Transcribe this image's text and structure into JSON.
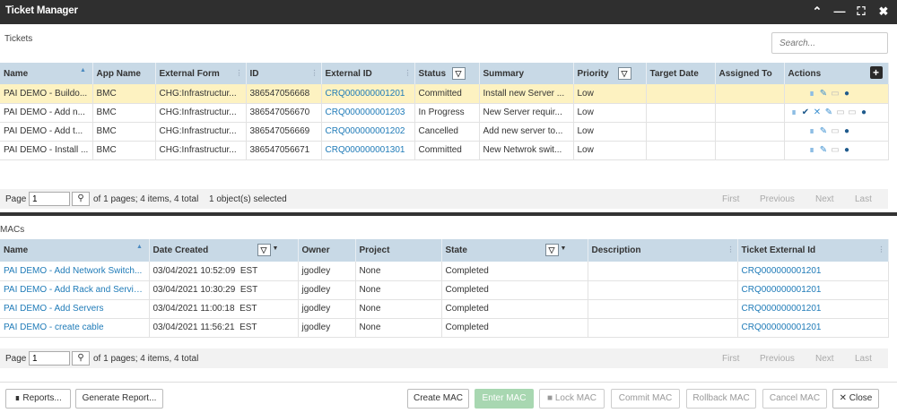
{
  "window": {
    "title": "Ticket Manager"
  },
  "tickets": {
    "section_label": "Tickets",
    "search_placeholder": "Search...",
    "columns": [
      "Name",
      "App Name",
      "External Form",
      "ID",
      "External ID",
      "Status",
      "Summary",
      "Priority",
      "Target Date",
      "Assigned To",
      "Actions"
    ],
    "rows": [
      {
        "name": "PAI DEMO - Buildo...",
        "app": "BMC",
        "form": "CHG:Infrastructur...",
        "id": "386547056668",
        "ext_id": "CRQ000000001201",
        "status": "Committed",
        "summary": "Install new Server ...",
        "priority": "Low",
        "target": "",
        "assigned": ""
      },
      {
        "name": "PAI DEMO - Add n...",
        "app": "BMC",
        "form": "CHG:Infrastructur...",
        "id": "386547056670",
        "ext_id": "CRQ000000001203",
        "status": "In Progress",
        "summary": "New Server requir...",
        "priority": "Low",
        "target": "",
        "assigned": ""
      },
      {
        "name": "PAI DEMO - Add t...",
        "app": "BMC",
        "form": "CHG:Infrastructur...",
        "id": "386547056669",
        "ext_id": "CRQ000000001202",
        "status": "Cancelled",
        "summary": "Add new server to...",
        "priority": "Low",
        "target": "",
        "assigned": ""
      },
      {
        "name": "PAI DEMO - Install ...",
        "app": "BMC",
        "form": "CHG:Infrastructur...",
        "id": "386547056671",
        "ext_id": "CRQ000000001301",
        "status": "Committed",
        "summary": "New Netwrok swit...",
        "priority": "Low",
        "target": "",
        "assigned": ""
      }
    ],
    "pager": {
      "page_label": "Page",
      "page_value": "1",
      "info": "of 1 pages; 4 items, 4 total",
      "selected": "1 object(s) selected",
      "first": "First",
      "previous": "Previous",
      "next": "Next",
      "last": "Last"
    }
  },
  "macs": {
    "section_label": "MACs",
    "columns": [
      "Name",
      "Date Created",
      "Owner",
      "Project",
      "State",
      "Description",
      "Ticket External Id"
    ],
    "rows": [
      {
        "name": "PAI DEMO - Add Network Switch...",
        "date": "03/04/2021 10:52:09",
        "tz": "EST",
        "owner": "jgodley",
        "project": "None",
        "state": "Completed",
        "desc": "",
        "ticket": "CRQ000000001201"
      },
      {
        "name": "PAI DEMO - Add Rack and Servic...",
        "date": "03/04/2021 10:30:29",
        "tz": "EST",
        "owner": "jgodley",
        "project": "None",
        "state": "Completed",
        "desc": "",
        "ticket": "CRQ000000001201"
      },
      {
        "name": "PAI DEMO - Add Servers",
        "date": "03/04/2021 11:00:18",
        "tz": "EST",
        "owner": "jgodley",
        "project": "None",
        "state": "Completed",
        "desc": "",
        "ticket": "CRQ000000001201"
      },
      {
        "name": "PAI DEMO - create cable",
        "date": "03/04/2021 11:56:21",
        "tz": "EST",
        "owner": "jgodley",
        "project": "None",
        "state": "Completed",
        "desc": "",
        "ticket": "CRQ000000001201"
      }
    ],
    "pager": {
      "page_label": "Page",
      "page_value": "1",
      "info": "of 1 pages; 4 items, 4 total",
      "first": "First",
      "previous": "Previous",
      "next": "Next",
      "last": "Last"
    }
  },
  "buttons": {
    "reports": "Reports...",
    "generate_report": "Generate Report...",
    "create_mac": "Create MAC",
    "enter_mac": "Enter MAC",
    "lock_mac": "Lock MAC",
    "commit_mac": "Commit MAC",
    "rollback_mac": "Rollback MAC",
    "cancel_mac": "Cancel MAC",
    "close": "Close"
  },
  "icons": {
    "collapse": "chevron-up-icon",
    "minimize": "minimize-icon",
    "maximize": "maximize-icon",
    "close": "close-icon",
    "search": "magnifier-icon",
    "filter": "funnel-icon",
    "add": "plus-icon",
    "chart": "bar-chart-icon",
    "edit": "pencil-icon",
    "delete": "trash-icon",
    "user": "user-icon",
    "commit": "checkmark-icon",
    "cancel": "x-icon",
    "lock": "lock-icon"
  },
  "colors": {
    "titlebar": "#2f2f2f",
    "header": "#c8d9e6",
    "selected_row": "#fdf2c1",
    "link": "#1f7bb8",
    "enter_mac": "#a8d7b1"
  }
}
